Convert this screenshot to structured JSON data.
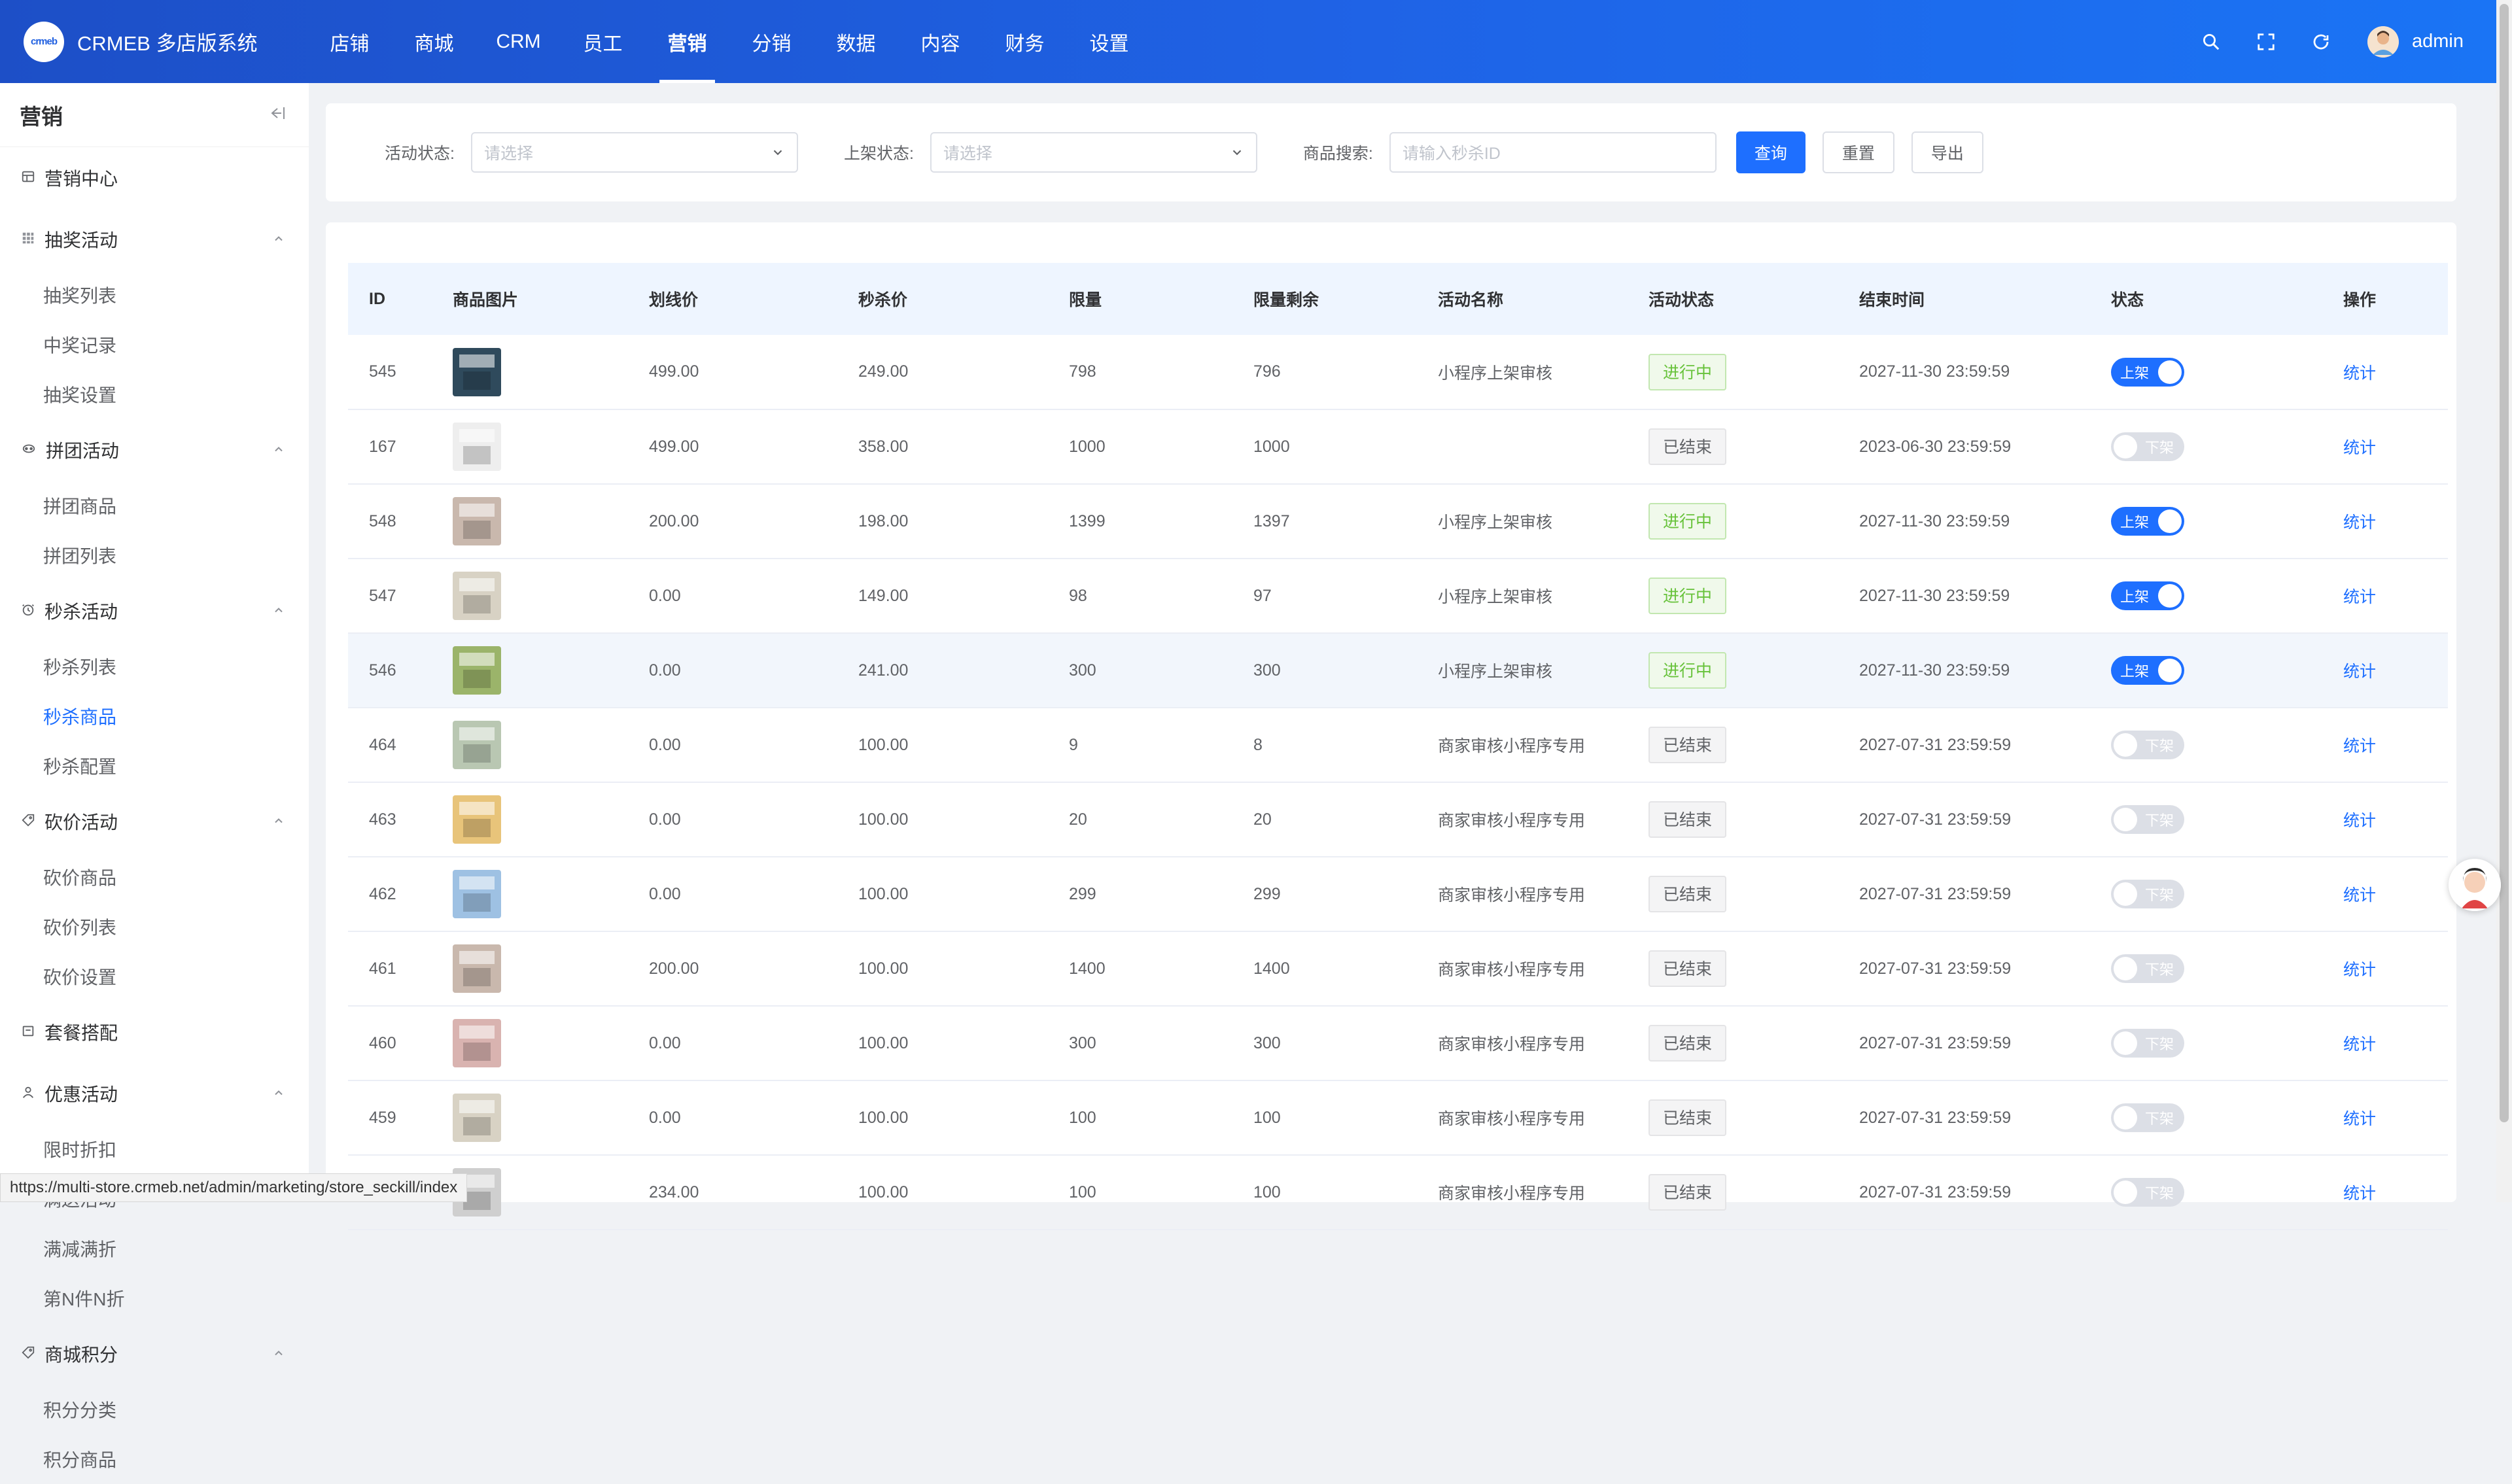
{
  "app": {
    "logo_text": "crmeb",
    "title": "CRMEB 多店版系统"
  },
  "topnav": [
    {
      "label": "店铺"
    },
    {
      "label": "商城"
    },
    {
      "label": "CRM"
    },
    {
      "label": "员工"
    },
    {
      "label": "营销",
      "active": true
    },
    {
      "label": "分销"
    },
    {
      "label": "数据"
    },
    {
      "label": "内容"
    },
    {
      "label": "财务"
    },
    {
      "label": "设置"
    }
  ],
  "user": {
    "name": "admin"
  },
  "sidebar": {
    "title": "营销",
    "groups": [
      {
        "label": "营销中心",
        "icon": "dashboard-icon",
        "items": []
      },
      {
        "label": "抽奖活动",
        "icon": "grid-icon",
        "items": [
          "抽奖列表",
          "中奖记录",
          "抽奖设置"
        ]
      },
      {
        "label": "拼团活动",
        "icon": "group-icon",
        "items": [
          "拼团商品",
          "拼团列表"
        ]
      },
      {
        "label": "秒杀活动",
        "icon": "clock-icon",
        "items": [
          "秒杀列表",
          "秒杀商品",
          "秒杀配置"
        ],
        "active_item": "秒杀商品"
      },
      {
        "label": "砍价活动",
        "icon": "tag-icon",
        "items": [
          "砍价商品",
          "砍价列表",
          "砍价设置"
        ]
      },
      {
        "label": "套餐搭配",
        "icon": "package-icon",
        "items": []
      },
      {
        "label": "优惠活动",
        "icon": "user-discount-icon",
        "items": [
          "限时折扣",
          "满送活动",
          "满减满折",
          "第N件N折"
        ]
      },
      {
        "label": "商城积分",
        "icon": "tag-icon",
        "items": [
          "积分分类",
          "积分商品"
        ]
      }
    ]
  },
  "filters": {
    "activity_status_label": "活动状态:",
    "activity_status_placeholder": "请选择",
    "shelf_status_label": "上架状态:",
    "shelf_status_placeholder": "请选择",
    "product_search_label": "商品搜索:",
    "product_search_placeholder": "请输入秒杀ID",
    "query_button": "查询",
    "reset_button": "重置",
    "export_button": "导出"
  },
  "table": {
    "columns": [
      "ID",
      "商品图片",
      "划线价",
      "秒杀价",
      "限量",
      "限量剩余",
      "活动名称",
      "活动状态",
      "结束时间",
      "状态",
      "操作"
    ],
    "action_label": "统计",
    "switch_on_label": "上架",
    "switch_off_label": "下架",
    "rows": [
      {
        "id": "545",
        "orig": "499.00",
        "price": "249.00",
        "limit": "798",
        "remain": "796",
        "name": "小程序上架审核",
        "status": "进行中",
        "end": "2027-11-30 23:59:59",
        "on": true,
        "thumb": "#2f4a5c"
      },
      {
        "id": "167",
        "orig": "499.00",
        "price": "358.00",
        "limit": "1000",
        "remain": "1000",
        "name": "",
        "status": "已结束",
        "end": "2023-06-30 23:59:59",
        "on": false,
        "thumb": "#eeeeee"
      },
      {
        "id": "548",
        "orig": "200.00",
        "price": "198.00",
        "limit": "1399",
        "remain": "1397",
        "name": "小程序上架审核",
        "status": "进行中",
        "end": "2027-11-30 23:59:59",
        "on": true,
        "thumb": "#c9b8ad"
      },
      {
        "id": "547",
        "orig": "0.00",
        "price": "149.00",
        "limit": "98",
        "remain": "97",
        "name": "小程序上架审核",
        "status": "进行中",
        "end": "2027-11-30 23:59:59",
        "on": true,
        "thumb": "#d8d2c4"
      },
      {
        "id": "546",
        "orig": "0.00",
        "price": "241.00",
        "limit": "300",
        "remain": "300",
        "name": "小程序上架审核",
        "status": "进行中",
        "end": "2027-11-30 23:59:59",
        "on": true,
        "thumb": "#9bb46a",
        "highlight": true
      },
      {
        "id": "464",
        "orig": "0.00",
        "price": "100.00",
        "limit": "9",
        "remain": "8",
        "name": "商家审核小程序专用",
        "status": "已结束",
        "end": "2027-07-31 23:59:59",
        "on": false,
        "thumb": "#b9c7b2"
      },
      {
        "id": "463",
        "orig": "0.00",
        "price": "100.00",
        "limit": "20",
        "remain": "20",
        "name": "商家审核小程序专用",
        "status": "已结束",
        "end": "2027-07-31 23:59:59",
        "on": false,
        "thumb": "#e8c47a"
      },
      {
        "id": "462",
        "orig": "0.00",
        "price": "100.00",
        "limit": "299",
        "remain": "299",
        "name": "商家审核小程序专用",
        "status": "已结束",
        "end": "2027-07-31 23:59:59",
        "on": false,
        "thumb": "#9ec1e3"
      },
      {
        "id": "461",
        "orig": "200.00",
        "price": "100.00",
        "limit": "1400",
        "remain": "1400",
        "name": "商家审核小程序专用",
        "status": "已结束",
        "end": "2027-07-31 23:59:59",
        "on": false,
        "thumb": "#c9b8ad"
      },
      {
        "id": "460",
        "orig": "0.00",
        "price": "100.00",
        "limit": "300",
        "remain": "300",
        "name": "商家审核小程序专用",
        "status": "已结束",
        "end": "2027-07-31 23:59:59",
        "on": false,
        "thumb": "#d9b3b0"
      },
      {
        "id": "459",
        "orig": "0.00",
        "price": "100.00",
        "limit": "100",
        "remain": "100",
        "name": "商家审核小程序专用",
        "status": "已结束",
        "end": "2027-07-31 23:59:59",
        "on": false,
        "thumb": "#d8d2c4"
      },
      {
        "id": "",
        "orig": "234.00",
        "price": "100.00",
        "limit": "100",
        "remain": "100",
        "name": "商家审核小程序专用",
        "status": "已结束",
        "end": "2027-07-31 23:59:59",
        "on": false,
        "thumb": "#cfcfcf"
      }
    ]
  },
  "status_bar_url": "https://multi-store.crmeb.net/admin/marketing/store_seckill/index",
  "colors": {
    "primary": "#1e6fff",
    "topbar": "#1f5fe0",
    "success": "#67c23a"
  }
}
